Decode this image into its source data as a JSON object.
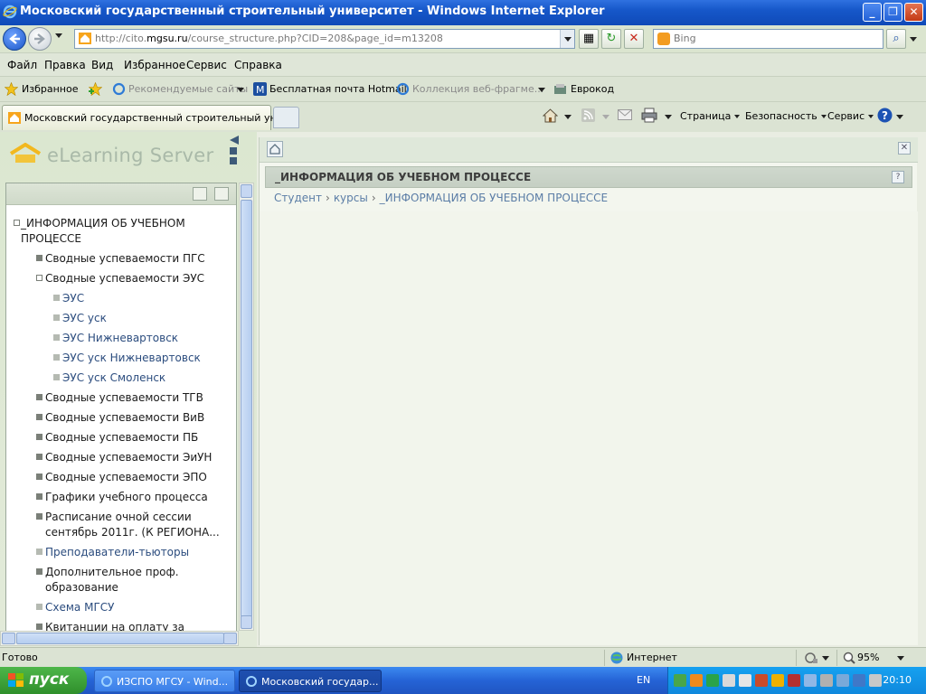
{
  "window": {
    "title": "Московский государственный строительный университет - Windows Internet Explorer"
  },
  "address": {
    "url_prefix": "http://cito.",
    "url_domain": "mgsu.ru",
    "url_rest": "/course_structure.php?CID=208&page_id=m13208",
    "search_placeholder": "Bing"
  },
  "menu": [
    "Файл",
    "Правка",
    "Вид",
    "Избранное",
    "Сервис",
    "Справка"
  ],
  "favorites_bar": {
    "favorites_label": "Избранное",
    "suggested_sites": "Рекомендуемые сайты",
    "hotmail": "Бесплатная почта Hotmail",
    "web_slices": "Коллекция веб-фрагме...",
    "eurocode": "Еврокод"
  },
  "tab": {
    "active_title": "Московский государственный строительный унив..."
  },
  "command_bar": {
    "page": "Страница",
    "safety": "Безопасность",
    "tools": "Сервис"
  },
  "app": {
    "logo_text": "eLearning Server"
  },
  "tree": {
    "items": [
      {
        "label": "_ИНФОРМАЦИЯ ОБ УЧЕБНОМ",
        "label2": "ПРОЦЕССЕ",
        "state": "open",
        "style": "dark"
      },
      {
        "label": "Сводные успеваемости ПГС",
        "state": "closed",
        "style": "dark"
      },
      {
        "label": "Сводные успеваемости ЭУС",
        "state": "open",
        "style": "dark"
      },
      {
        "label": "ЭУС",
        "state": "leaf",
        "style": "link"
      },
      {
        "label": "ЭУС уск",
        "state": "leaf",
        "style": "link"
      },
      {
        "label": "ЭУС Нижневартовск",
        "state": "leaf",
        "style": "link"
      },
      {
        "label": "ЭУС уск Нижневартовск",
        "state": "leaf",
        "style": "link"
      },
      {
        "label": "ЭУС уск Смоленск",
        "state": "leaf",
        "style": "link"
      },
      {
        "label": "Сводные успеваемости ТГВ",
        "state": "closed",
        "style": "dark"
      },
      {
        "label": "Сводные успеваемости ВиВ",
        "state": "closed",
        "style": "dark"
      },
      {
        "label": "Сводные успеваемости ПБ",
        "state": "closed",
        "style": "dark"
      },
      {
        "label": "Сводные успеваемости ЭиУН",
        "state": "closed",
        "style": "dark"
      },
      {
        "label": "Сводные успеваемости ЭПО",
        "state": "closed",
        "style": "dark"
      },
      {
        "label": "Графики учебного процесса",
        "state": "closed",
        "style": "dark"
      },
      {
        "label": "Расписание очной сессии",
        "label2": "сентябрь 2011г. (К РЕГИОНА...",
        "state": "closed",
        "style": "dark"
      },
      {
        "label": "Преподаватели-тьюторы",
        "state": "leaf",
        "style": "link"
      },
      {
        "label": "Дополнительное проф.",
        "label2": "образование",
        "state": "closed",
        "style": "dark"
      },
      {
        "label": "Схема МГСУ",
        "state": "leaf",
        "style": "link"
      },
      {
        "label": "Квитанции на оплату за",
        "state": "closed",
        "style": "dark"
      }
    ]
  },
  "main": {
    "panel_title": "_ИНФОРМАЦИЯ ОБ УЧЕБНОМ ПРОЦЕССЕ",
    "breadcrumb": [
      "Студент",
      "курсы",
      "_ИНФОРМАЦИЯ ОБ УЧЕБНОМ ПРОЦЕССЕ"
    ],
    "breadcrumb_sep": "›"
  },
  "status": {
    "left": "Готово",
    "zone": "Интернет",
    "zoom": "95%"
  },
  "taskbar": {
    "start_label": "пуск",
    "tasks": [
      "ИЗСПО МГСУ - Wind...",
      "Московский государ..."
    ],
    "language": "EN",
    "clock": "20:10"
  },
  "colors": {
    "titlebar": "#1657c9",
    "link": "#2b4c7e",
    "breadcrumb": "#5b7da6",
    "taskbar": "#2563d6",
    "start": "#3a9f36"
  }
}
